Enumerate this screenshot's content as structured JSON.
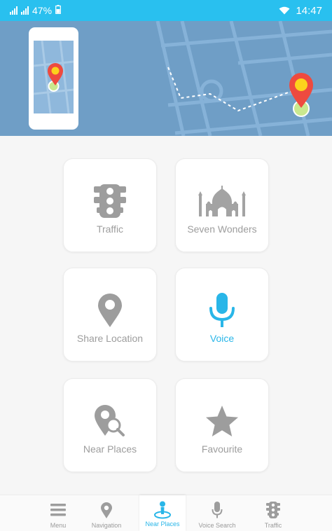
{
  "status_bar": {
    "battery": "47%",
    "time": "14:47"
  },
  "tiles": [
    {
      "label": "Traffic",
      "icon": "traffic-light-icon"
    },
    {
      "label": "Seven Wonders",
      "icon": "taj-mahal-icon"
    },
    {
      "label": "Share Location",
      "icon": "map-pin-icon"
    },
    {
      "label": "Voice",
      "icon": "microphone-icon",
      "active": true
    },
    {
      "label": "Near Places",
      "icon": "pin-search-icon"
    },
    {
      "label": "Favourite",
      "icon": "star-icon"
    }
  ],
  "bottom_nav": [
    {
      "label": "Menu",
      "icon": "menu-icon"
    },
    {
      "label": "Navigation",
      "icon": "map-pin-icon"
    },
    {
      "label": "Near Places",
      "icon": "near-places-icon",
      "active": true
    },
    {
      "label": "Voice Search",
      "icon": "microphone-icon"
    },
    {
      "label": "Traffic",
      "icon": "traffic-light-icon"
    }
  ],
  "colors": {
    "accent": "#29b6e8",
    "status_bar": "#29c0ef",
    "banner": "#6f9ec6",
    "pin_red": "#ee4a3f",
    "pin_yellow": "#fcd21c",
    "icon_grey": "#9d9d9d"
  }
}
